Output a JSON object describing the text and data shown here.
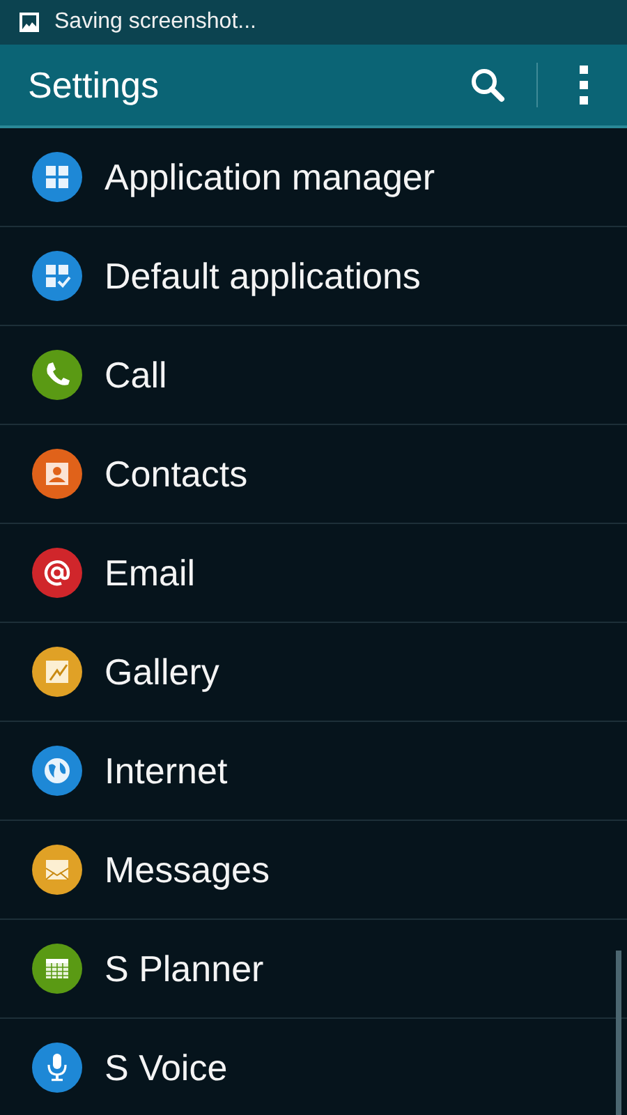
{
  "status_bar": {
    "notification": "Saving screenshot..."
  },
  "app_bar": {
    "title": "Settings"
  },
  "items": [
    {
      "label": "Application manager",
      "kind": "grid",
      "color": "#1e88d6"
    },
    {
      "label": "Default applications",
      "kind": "grid-check",
      "color": "#1e88d6"
    },
    {
      "label": "Call",
      "kind": "phone",
      "color": "#5a9a14"
    },
    {
      "label": "Contacts",
      "kind": "contact",
      "color": "#e0621a"
    },
    {
      "label": "Email",
      "kind": "at",
      "color": "#d0262b"
    },
    {
      "label": "Gallery",
      "kind": "gallery",
      "color": "#e0a126"
    },
    {
      "label": "Internet",
      "kind": "globe",
      "color": "#1e88d6"
    },
    {
      "label": "Messages",
      "kind": "envelope",
      "color": "#e0a126"
    },
    {
      "label": "S Planner",
      "kind": "calendar",
      "color": "#5a9a14"
    },
    {
      "label": "S Voice",
      "kind": "mic",
      "color": "#1e88d6"
    }
  ]
}
